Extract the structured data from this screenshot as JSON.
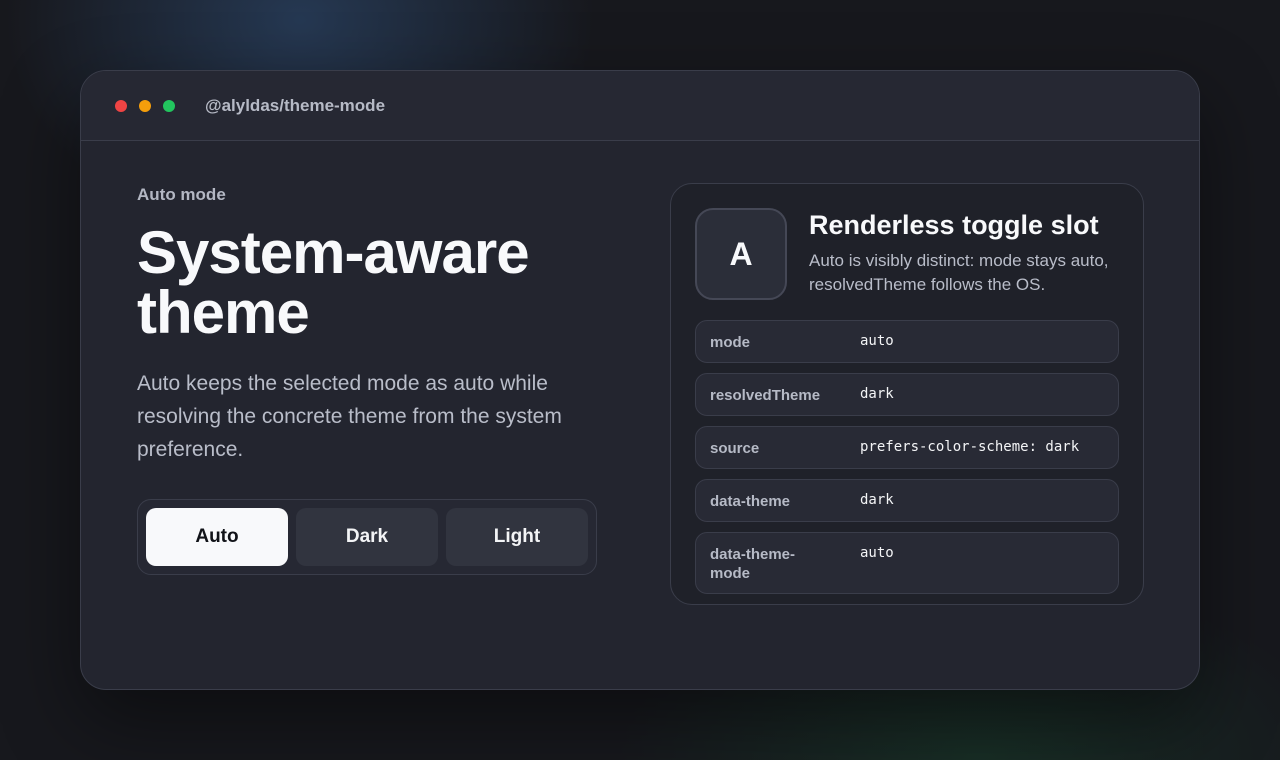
{
  "window": {
    "package_name": "@alyldas/theme-mode"
  },
  "hero": {
    "eyebrow": "Auto mode",
    "title_line1": "System-aware",
    "title_line2": "theme",
    "description": "Auto keeps the selected mode as auto while resolving the concrete theme from the system preference."
  },
  "mode_switch": {
    "selected": "Auto",
    "options": [
      {
        "label": "Auto"
      },
      {
        "label": "Dark"
      },
      {
        "label": "Light"
      }
    ]
  },
  "slot_card": {
    "glyph": "A",
    "title": "Renderless toggle slot",
    "subtitle": "Auto is visibly distinct: mode stays auto, resolvedTheme follows the OS.",
    "rows": [
      {
        "key": "mode",
        "value": "auto"
      },
      {
        "key": "resolvedTheme",
        "value": "dark"
      },
      {
        "key": "source",
        "value": "prefers-color-scheme: dark"
      },
      {
        "key": "data-theme",
        "value": "dark"
      },
      {
        "key": "data-theme-mode",
        "value": "auto"
      }
    ]
  },
  "colors": {
    "traffic_red": "#ef4444",
    "traffic_amber": "#f59e0b",
    "traffic_green": "#22c55e",
    "active_segment": "#f8f9fb",
    "window_bg": "#23252f"
  }
}
